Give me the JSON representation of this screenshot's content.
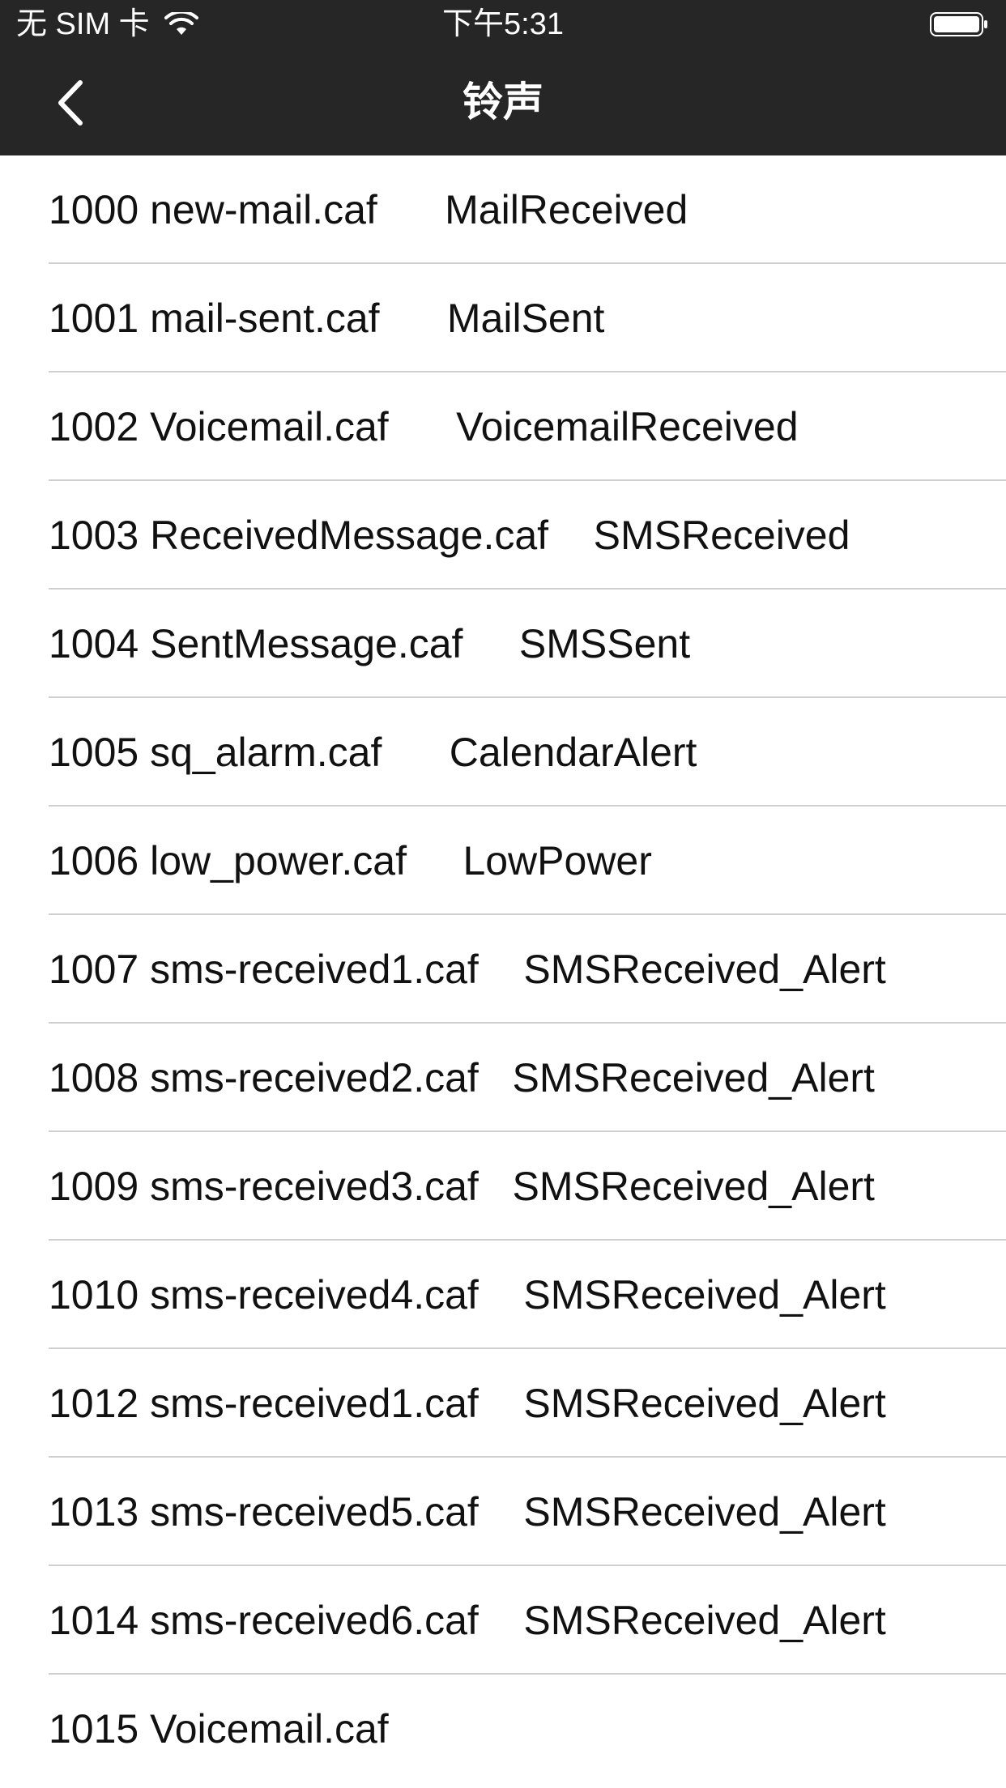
{
  "status_bar": {
    "carrier": "无 SIM 卡",
    "time": "下午5:31"
  },
  "navbar": {
    "title": "铃声",
    "back_icon": "chevron-left-icon"
  },
  "sounds": [
    {
      "id_file": "1000 new-mail.caf",
      "event": "MailReceived",
      "gap": "      "
    },
    {
      "id_file": "1001 mail-sent.caf",
      "event": "MailSent",
      "gap": "      "
    },
    {
      "id_file": "1002 Voicemail.caf",
      "event": "VoicemailReceived",
      "gap": "      "
    },
    {
      "id_file": "1003 ReceivedMessage.caf",
      "event": "SMSReceived",
      "gap": "    "
    },
    {
      "id_file": "1004 SentMessage.caf",
      "event": "SMSSent",
      "gap": "     "
    },
    {
      "id_file": "1005 sq_alarm.caf",
      "event": "CalendarAlert",
      "gap": "      "
    },
    {
      "id_file": "1006 low_power.caf",
      "event": "LowPower",
      "gap": "     "
    },
    {
      "id_file": "1007 sms-received1.caf",
      "event": "SMSReceived_Alert",
      "gap": "    "
    },
    {
      "id_file": "1008 sms-received2.caf",
      "event": "SMSReceived_Alert",
      "gap": "   "
    },
    {
      "id_file": "1009 sms-received3.caf",
      "event": "SMSReceived_Alert",
      "gap": "   "
    },
    {
      "id_file": "1010 sms-received4.caf",
      "event": "SMSReceived_Alert",
      "gap": "    "
    },
    {
      "id_file": "1012 sms-received1.caf",
      "event": "SMSReceived_Alert",
      "gap": "    "
    },
    {
      "id_file": "1013 sms-received5.caf",
      "event": "SMSReceived_Alert",
      "gap": "    "
    },
    {
      "id_file": "1014 sms-received6.caf",
      "event": "SMSReceived_Alert",
      "gap": "    "
    },
    {
      "id_file": "1015 Voicemail.caf",
      "event": "",
      "gap": ""
    }
  ],
  "colors": {
    "header_bg": "#262626",
    "text": "#111111",
    "separator": "#d0d0d0"
  }
}
